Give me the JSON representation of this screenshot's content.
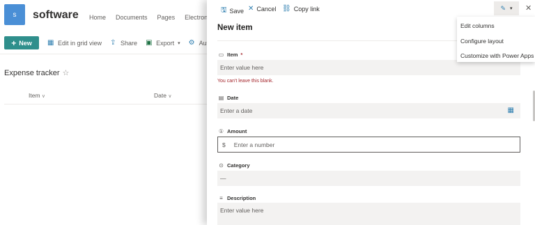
{
  "site": {
    "logo_letter": "s",
    "title": "software",
    "nav": [
      "Home",
      "Documents",
      "Pages",
      "Electroni"
    ]
  },
  "command_bar": {
    "new_label": "New",
    "edit_grid_label": "Edit in grid view",
    "share_label": "Share",
    "export_label": "Export",
    "automate_label": "Auto"
  },
  "list": {
    "title": "Expense tracker",
    "columns": [
      {
        "label": "Item"
      },
      {
        "label": "Date"
      }
    ]
  },
  "panel": {
    "toolbar": {
      "save_label": "Save",
      "cancel_label": "Cancel",
      "copy_link_label": "Copy link"
    },
    "title": "New item",
    "fields": {
      "item": {
        "label": "Item",
        "required_mark": "*",
        "placeholder": "Enter value here",
        "error": "You can't leave this blank."
      },
      "date": {
        "label": "Date",
        "placeholder": "Enter a date"
      },
      "amount": {
        "label": "Amount",
        "prefix": "$",
        "placeholder": "Enter a number"
      },
      "category": {
        "label": "Category",
        "value": "—"
      },
      "description": {
        "label": "Description",
        "placeholder": "Enter value here"
      }
    }
  },
  "menu": {
    "items": [
      "Edit columns",
      "Configure layout",
      "Customize with Power Apps"
    ]
  },
  "colors": {
    "accent": "#2f8f8c",
    "link_blue": "#2f7fb0",
    "error": "#a4262c",
    "logo_bg": "#4a8fd6"
  }
}
